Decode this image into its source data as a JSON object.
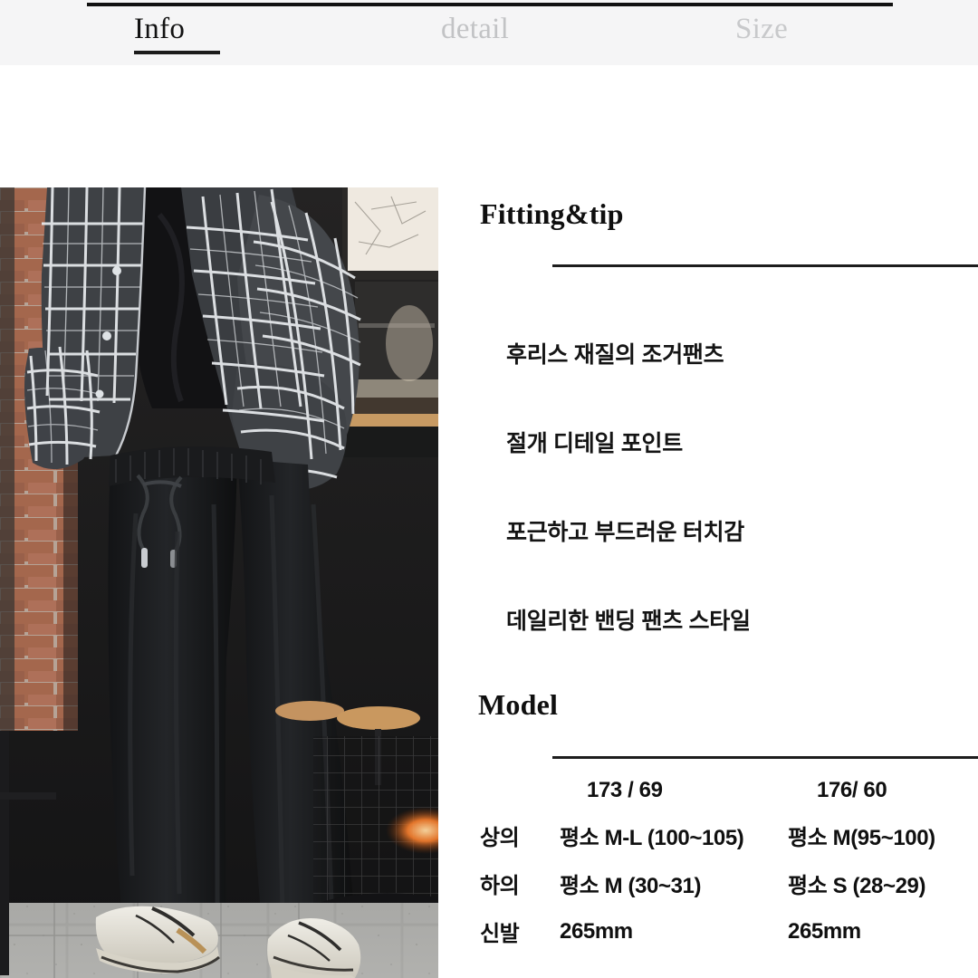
{
  "tabs": [
    {
      "label": "Info",
      "active": true,
      "name": "tab-info"
    },
    {
      "label": "detail",
      "active": false,
      "name": "tab-detail"
    },
    {
      "label": "Size",
      "active": false,
      "name": "tab-size"
    }
  ],
  "sections": {
    "fitting": {
      "title": "Fitting&tip",
      "bullets": [
        "후리스 재질의 조거팬츠",
        "절개 디테일 포인트",
        "포근하고 부드러운 터치감",
        "데일리한 밴딩 팬츠 스타일"
      ]
    },
    "model": {
      "title": "Model",
      "header": {
        "label": "",
        "model_a": "173 / 69",
        "model_b": "176/ 60"
      },
      "rows": [
        {
          "label": "상의",
          "model_a": "평소 M-L (100~105)",
          "model_b": "평소 M(95~100)"
        },
        {
          "label": "하의",
          "model_a": "평소 M (30~31)",
          "model_b": "평소 S (28~29)"
        },
        {
          "label": "신발",
          "model_a": "265mm",
          "model_b": "265mm"
        }
      ]
    }
  },
  "photo": {
    "alt": "model-wearing-plaid-puffer-jacket-and-black-jogger-pants",
    "colors": {
      "brick": "#9c6a51",
      "mortar": "#b8a99c",
      "jacket_dark": "#3c3f42",
      "jacket_line": "#e9ecef",
      "pants": "#17181a",
      "sneaker": "#e3e1da",
      "pavement": "#a9a9a7",
      "interior": "#1a1a1c",
      "wood": "#c89a64",
      "flame": "#e8732a"
    }
  },
  "theme": {
    "tabbar_bg": "#f5f5f6",
    "text_primary": "#111111",
    "text_muted": "#c5c6c8",
    "rule": "#1d1d1d",
    "page_bg": "#ffffff"
  }
}
